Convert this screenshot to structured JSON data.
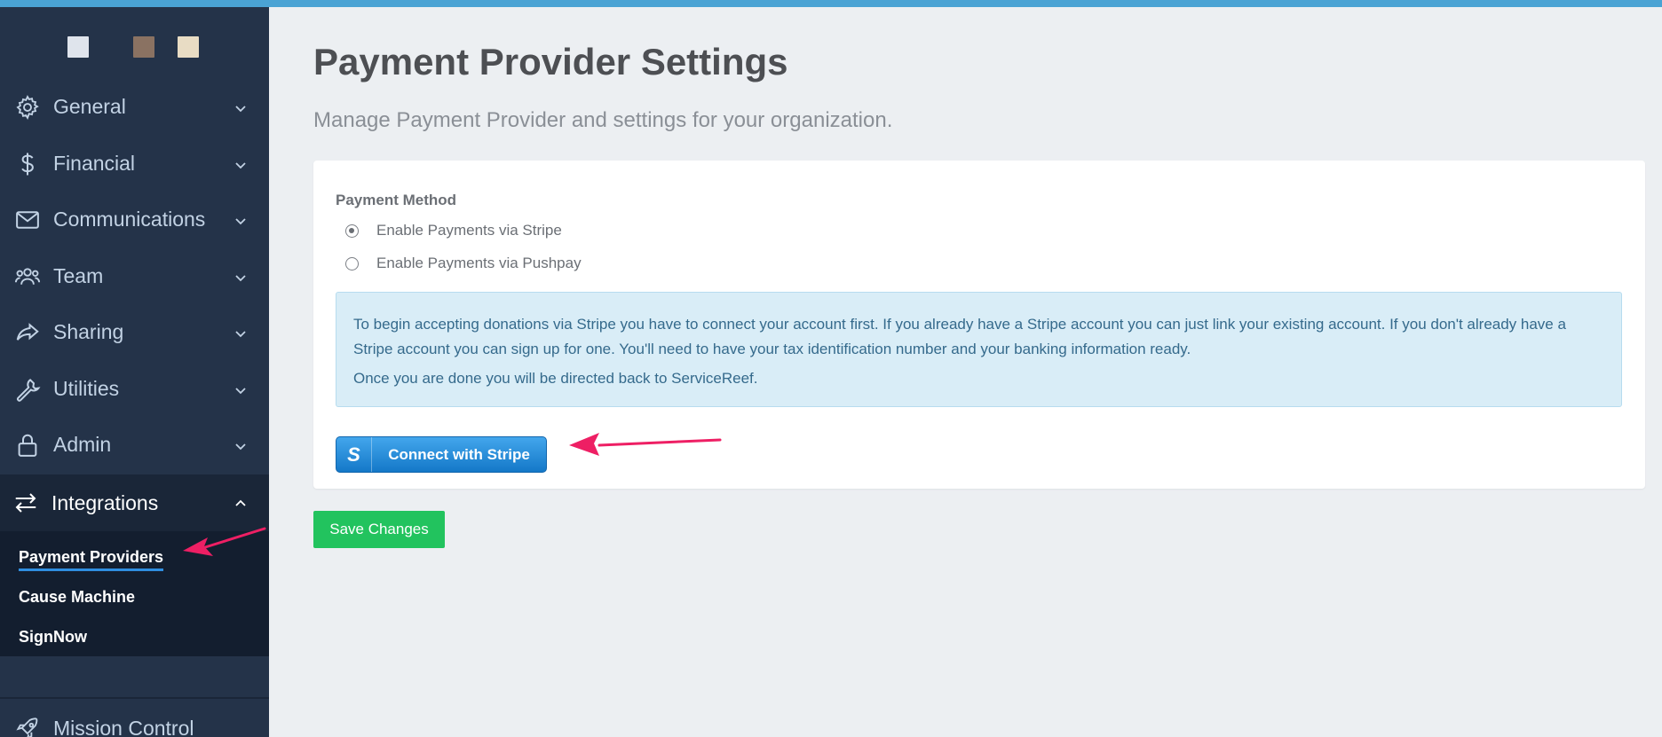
{
  "sidebar": {
    "swatch_colors": [
      "#dfe4ec",
      "#8a7262",
      "#e8dcc4"
    ],
    "nav_items": [
      {
        "label": "General",
        "icon": "gear-icon"
      },
      {
        "label": "Financial",
        "icon": "dollar-icon"
      },
      {
        "label": "Communications",
        "icon": "envelope-icon"
      },
      {
        "label": "Team",
        "icon": "users-icon"
      },
      {
        "label": "Sharing",
        "icon": "share-icon"
      },
      {
        "label": "Utilities",
        "icon": "wrench-icon"
      },
      {
        "label": "Admin",
        "icon": "lock-icon"
      }
    ],
    "integrations": {
      "label": "Integrations",
      "icon": "exchange-icon",
      "sub_items": [
        "Payment Providers",
        "Cause Machine",
        "SignNow"
      ],
      "active": "Payment Providers"
    },
    "bottom_item": {
      "label": "Mission Control",
      "icon": "rocket-icon"
    }
  },
  "main": {
    "title": "Payment Provider Settings",
    "subtitle": "Manage Payment Provider and settings for your organization.",
    "payment_method": {
      "label": "Payment Method",
      "options": [
        {
          "label": "Enable Payments via Stripe",
          "selected": true
        },
        {
          "label": "Enable Payments via Pushpay",
          "selected": false
        }
      ]
    },
    "info": {
      "text1": "To begin accepting donations via Stripe you have to connect your account first. If you already have a Stripe account you can just link your existing account. If you don't already have a Stripe account you can sign up for one. You'll need to have your tax identification number and your banking information ready.",
      "text2": "Once you are done you will be directed back to ServiceReef."
    },
    "stripe_button": {
      "icon_letter": "S",
      "label": "Connect with Stripe"
    },
    "save_button": "Save Changes"
  },
  "colors": {
    "accent_bar": "#4aa3d4",
    "sidebar_bg": "#243349",
    "save_green": "#22c35e",
    "stripe_blue": "#1f88d8",
    "annotation_arrow": "#ee1f64"
  }
}
